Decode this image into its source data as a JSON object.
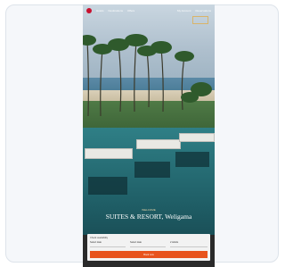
{
  "nav": {
    "links": [
      "Hotels",
      "Destinations",
      "Offers"
    ],
    "right_links": [
      "My Account",
      "Reservations"
    ]
  },
  "hero": {
    "eyebrow": "WELCOME",
    "title": "SUITES & RESORT, Weligama"
  },
  "booking": {
    "heading": "Check availability",
    "fields": [
      {
        "label": "Check in",
        "value": "Select date"
      },
      {
        "label": "Check out",
        "value": "Select date"
      },
      {
        "label": "Guests",
        "value": "2 Adults"
      }
    ],
    "button_label": "Book now"
  },
  "colors": {
    "brand_red": "#c8102e",
    "accent_orange": "#e8531d",
    "gold": "#d9b46a"
  }
}
